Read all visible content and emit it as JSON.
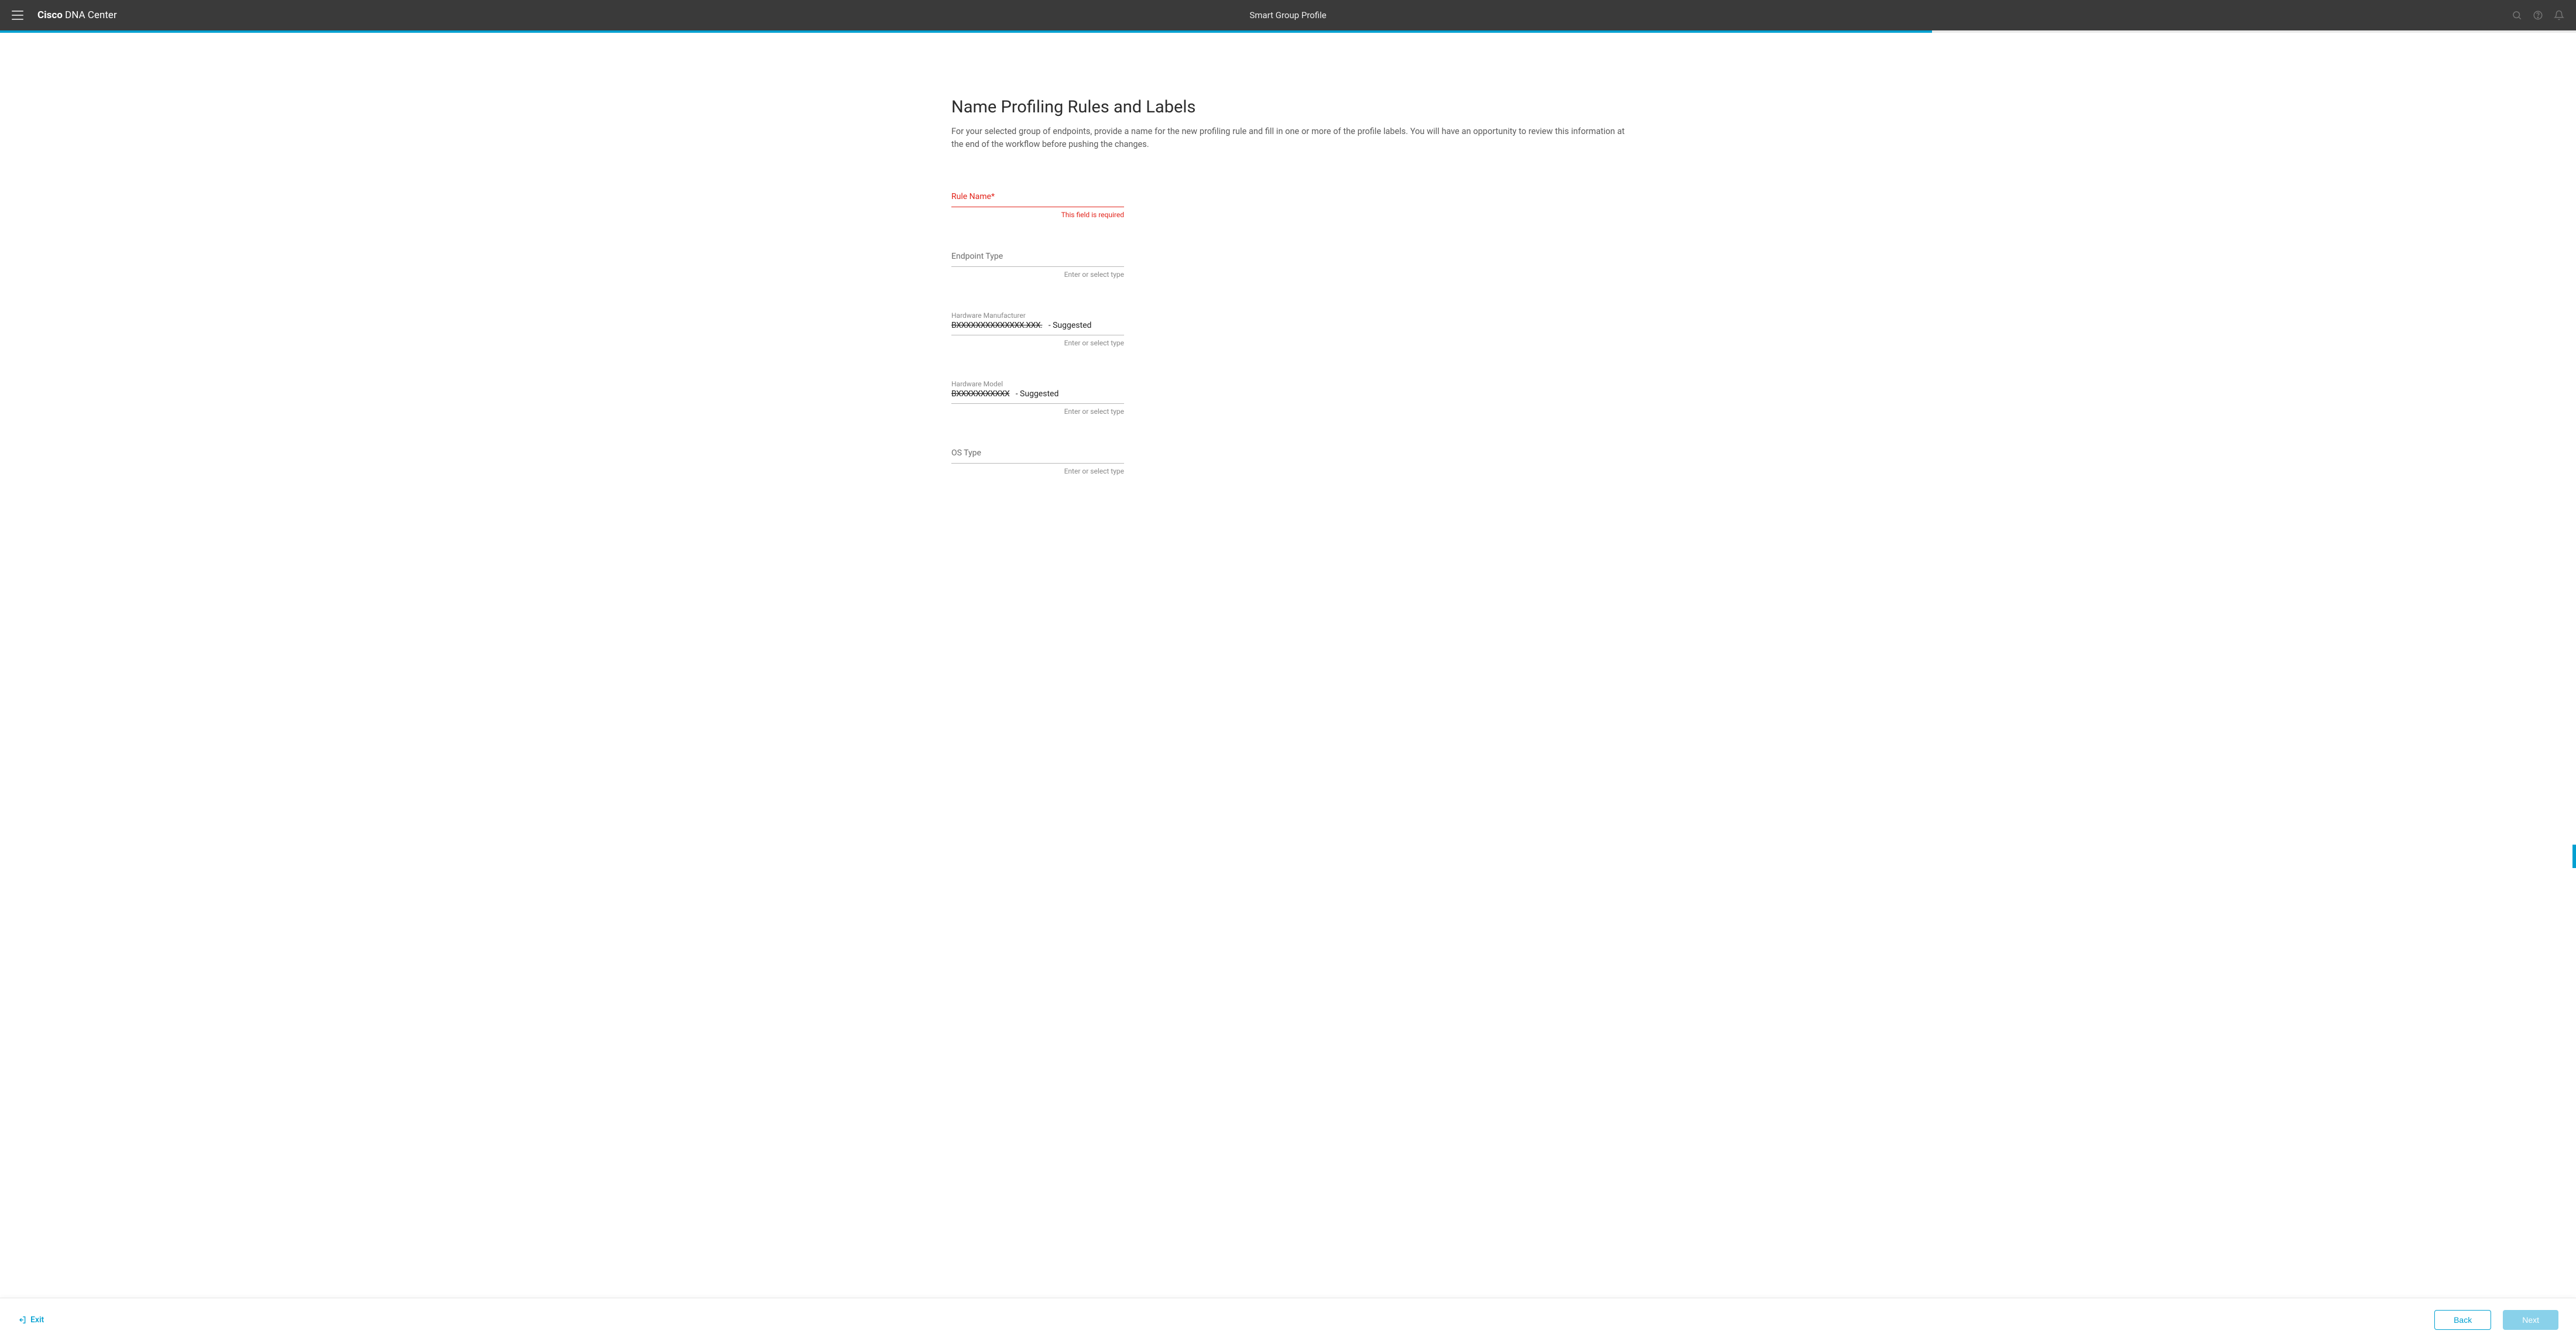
{
  "header": {
    "brand_bold": "Cisco",
    "brand_rest": "DNA Center",
    "title": "Smart Group Profile"
  },
  "progress": {
    "percent": 75
  },
  "page": {
    "title": "Name Profiling Rules and Labels",
    "description": "For your selected group of endpoints, provide a name for the new profiling rule and fill in one or more of the profile labels. You will have an opportunity to review this information at the end of the workflow before pushing the changes."
  },
  "form": {
    "rule_name": {
      "label": "Rule Name",
      "required_marker": "*",
      "error": "This field is required"
    },
    "endpoint_type": {
      "label": "Endpoint Type",
      "helper": "Enter or select type"
    },
    "hardware_manufacturer": {
      "label": "Hardware Manufacturer",
      "value_struck": "BXXXXXXXXXXXXXX.XXX.",
      "value_suffix": " - Suggested",
      "helper": "Enter or select type"
    },
    "hardware_model": {
      "label": "Hardware Model",
      "value_struck": "BXXXXXXXXXXX",
      "value_suffix": " - Suggested",
      "helper": "Enter or select type"
    },
    "os_type": {
      "label": "OS Type",
      "helper": "Enter or select type"
    }
  },
  "footer": {
    "exit": "Exit",
    "back": "Back",
    "next": "Next"
  }
}
